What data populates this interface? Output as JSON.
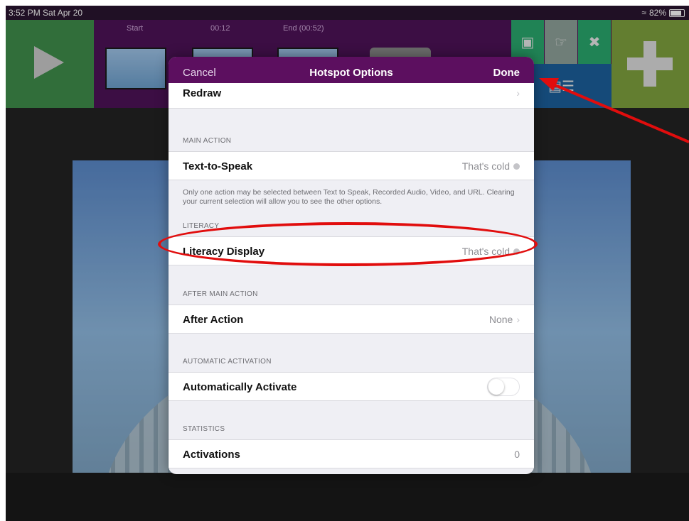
{
  "status_bar": {
    "time": "3:52 PM  Sat Apr 20",
    "battery": "82%",
    "battery_level": 0.82
  },
  "timeline": {
    "labels": [
      "Start",
      "00:12",
      "End (00:52)"
    ]
  },
  "modal": {
    "cancel_label": "Cancel",
    "title": "Hotspot Options",
    "done_label": "Done",
    "redraw_label": "Redraw",
    "main_action": {
      "header": "MAIN ACTION",
      "row_label": "Text-to-Speak",
      "row_value": "That's cold",
      "note": "Only one action may be selected between Text to Speak, Recorded Audio, Video, and URL.  Clearing your current selection will allow you to see the other options."
    },
    "literacy": {
      "header": "LITERACY",
      "row_label": "Literacy Display",
      "row_value": "That's cold"
    },
    "after_main_action": {
      "header": "AFTER MAIN ACTION",
      "row_label": "After Action",
      "row_value": "None"
    },
    "automatic_activation": {
      "header": "AUTOMATIC ACTIVATION",
      "row_label": "Automatically Activate",
      "toggle_on": false
    },
    "statistics": {
      "header": "STATISTICS",
      "row_label": "Activations",
      "row_value": "0"
    }
  },
  "colors": {
    "nav": "#5c0f5f",
    "annotation": "#e10d0d",
    "play": "#3f8e4b",
    "add": "#7fa23e"
  },
  "icons": [
    "play-icon",
    "resize-icon",
    "touch-icon",
    "close-icon",
    "image-text-icon",
    "plus-icon",
    "wifi-icon",
    "battery-icon"
  ]
}
